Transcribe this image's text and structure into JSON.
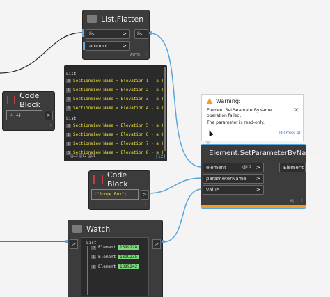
{
  "list_flatten": {
    "title": "List.Flatten",
    "in1": "list",
    "in2": "amount",
    "out": "list",
    "lacing": "AUTO"
  },
  "preview": {
    "header1": "List",
    "rows1": [
      "SectionView(Name = Elevation 1 - a )",
      "SectionView(Name = Elevation 2 - a )",
      "SectionView(Name = Elevation 3 - a )",
      "SectionView(Name = Elevation 4 - a )"
    ],
    "header2": "List",
    "rows2": [
      "SectionView(Name = Elevation 5 - a )",
      "SectionView(Name = Elevation 6 - a )",
      "SectionView(Name = Elevation 7 - a )",
      "SectionView(Name = Elevation 8 - a )"
    ],
    "footer_left": "@L3 @L2 @L1",
    "footer_right": "{12}"
  },
  "code_block_1": {
    "title": "Code Block",
    "code": "1;"
  },
  "code_block_2": {
    "title": "Code Block",
    "code": "\"Scope Box\";"
  },
  "warning": {
    "title": "Warning:",
    "message1": "Element.SetParameterByName operation failed.",
    "message2": "The parameter is read-only.",
    "dismiss": "Dismiss all"
  },
  "set_param": {
    "title": "Element.SetParameterByName",
    "in1": "element",
    "in1_lacing": "@L2",
    "in2": "parameterName",
    "in3": "value",
    "out": "Element"
  },
  "watch": {
    "title": "Watch",
    "list_header": "List",
    "items": [
      {
        "index": "0",
        "label": "Element",
        "id": "1399228"
      },
      {
        "index": "1",
        "label": "Element",
        "id": "1399235"
      },
      {
        "index": "2",
        "label": "Element",
        "id": "1399242"
      }
    ]
  },
  "colors": {
    "wire": "#5aa6da",
    "node_bg": "#3c3c3c",
    "warning_bar": "#f39c1f",
    "item_id_bg": "#7cd67c"
  }
}
